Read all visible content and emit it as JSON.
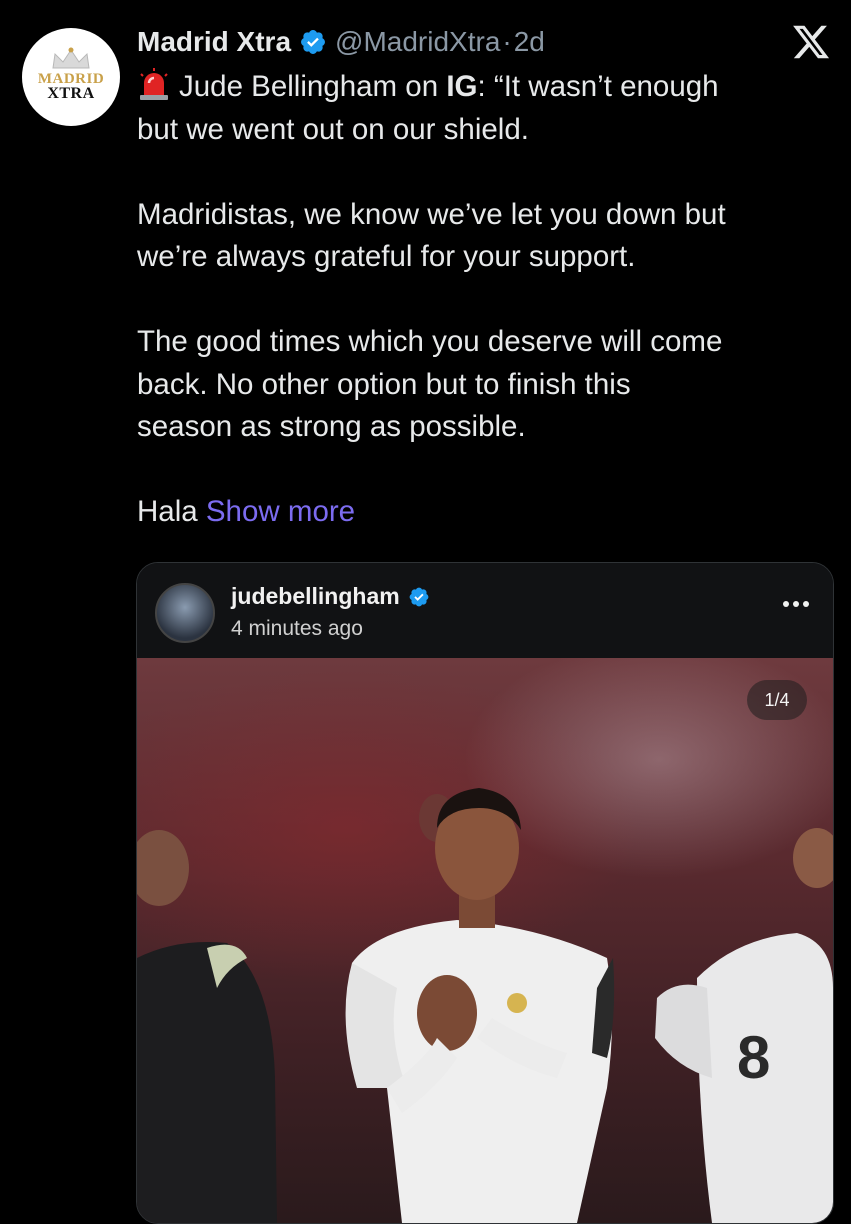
{
  "account": {
    "avatar_text_line1": "MADRID",
    "avatar_text_line2": "XTRA",
    "name": "Madrid Xtra",
    "handle": "@MadridXtra",
    "separator": "·",
    "time": "2d"
  },
  "tweet": {
    "line1_prefix": "Jude Bellingham on ",
    "line1_bold": "IG",
    "line1_suffix": ": “It wasn’t enough",
    "line2": "but we went out on our shield.",
    "para2_line1": "Madridistas, we know we’ve let you down but",
    "para2_line2": "we’re always grateful for your support.",
    "para3_line1": "The good times which you deserve will come",
    "para3_line2": "back. No other option but to finish this",
    "para3_line3": "season as strong as possible.",
    "last_word": "Hala ",
    "show_more": "Show more"
  },
  "embed": {
    "username": "judebellingham",
    "time": "4 minutes ago",
    "counter": "1/4"
  },
  "colors": {
    "background": "#000000",
    "text": "#e7e9ea",
    "muted": "#8b98a5",
    "link": "#7c6cf0",
    "verified": "#1d9bf0"
  },
  "icons": [
    "verified-badge-icon",
    "x-logo-icon",
    "siren-emoji-icon",
    "more-options-icon"
  ]
}
